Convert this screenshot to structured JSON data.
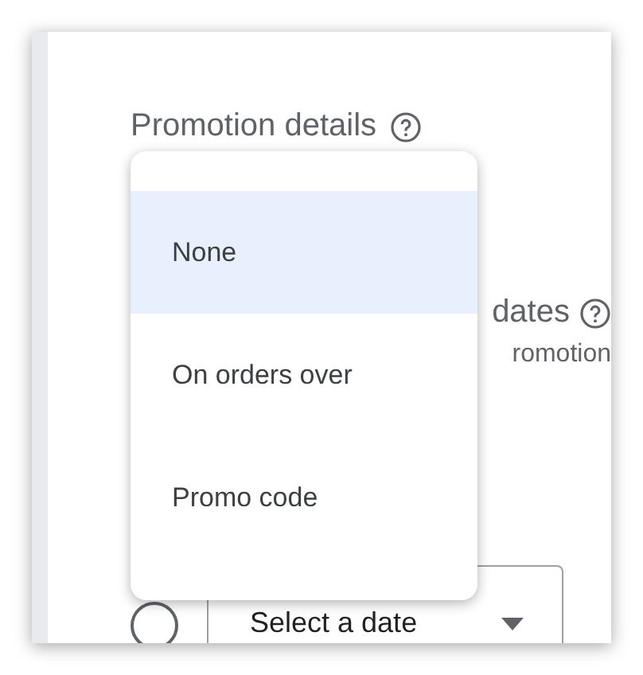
{
  "promotion_details": {
    "title": "Promotion details"
  },
  "promotion_dates": {
    "title": "dates",
    "subtitle": "romotion"
  },
  "date_row": {
    "radio_selected": false,
    "select_value": "Select a date"
  },
  "dropdown": {
    "options": [
      {
        "label": "None",
        "selected": true
      },
      {
        "label": "On orders over",
        "selected": false
      },
      {
        "label": "Promo code",
        "selected": false
      }
    ]
  }
}
